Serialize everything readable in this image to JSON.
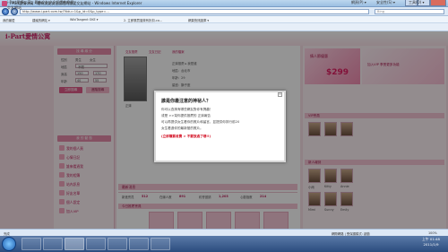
{
  "window": {
    "title": "i-Part愛情公寓 - 最有交友安全認證的戀愛交友網站 - Windows Internet Explorer"
  },
  "address": {
    "url": "http://www.i-part.com.tw/?tidu=1&p_id=0&p_type=...",
    "search_placeholder": "Bing"
  },
  "favorites": {
    "items": [
      "我的最愛",
      "建議的網站 ▾",
      "WikiTangent OKE ▾",
      "2. 立即購買運費有折扣-co...",
      "網頁快訊圖庫 ▾"
    ]
  },
  "tabs": [
    {
      "label": "i-Part愛情公寓 - 最有交友安全認證的戀愛交友網站"
    }
  ],
  "toolbar": {
    "items": [
      "網頁(P) ▾",
      "安全性(S) ▾",
      "工具(O) ▾"
    ]
  },
  "site": {
    "logo": "i-Part愛情公寓",
    "left": {
      "search_head": "找 尋 緣 分",
      "gender_label": "性別",
      "gender_options": [
        "男生",
        "女生"
      ],
      "area_label": "地區",
      "area_value": "不限",
      "height_label": "身高",
      "height_values": [
        "150",
        "170"
      ],
      "age_label": "年齡",
      "age_values": [
        "40",
        "55"
      ],
      "search_button": "立即搜尋",
      "advanced_button": "進階搜尋",
      "my_head": "我 的 動 態",
      "menu": [
        "我的個人頁",
        "心情日記",
        "誰來看過我",
        "我的相簿",
        "站內訊息",
        "好友名單",
        "個人設定",
        "加入VIP"
      ]
    },
    "main": {
      "links": [
        "交友推薦",
        "交友日記",
        "我的檔案"
      ],
      "member_label": "正妹",
      "info_lines": [
        "正妹推薦 ▸ 我是誰",
        "地區：台北市",
        "年齡：29",
        "星座：獅子座",
        "興趣：看電影"
      ],
      "stats_head": "最新消息",
      "stats": [
        {
          "label": "新進會員",
          "value": "512"
        },
        {
          "label": "在線人數",
          "value": "891"
        },
        {
          "label": "約會邀請",
          "value": "1,203"
        },
        {
          "label": "心動指數",
          "value": "214"
        }
      ],
      "avatars_head": "今日推薦會員"
    },
    "right": {
      "ad_price": "$299",
      "ad_text": "情人節優惠",
      "ad2_text": "加入VIP 享受更多功能",
      "vip_head": "VIP會員",
      "new_head": "新人報到",
      "names": [
        "小雨",
        "Kitty",
        "Annie",
        "Mimi",
        "Sunny",
        "Emily"
      ]
    }
  },
  "dialog": {
    "title": "誰是你最注意的神祕人？",
    "lines": [
      "你可以查詢有哪些網友對你有興趣！",
      "或是 >>幫你提供推薦的 正妹報告",
      "可以再提供女生看你的照片和留言，並提供你排行前20",
      "女生看過你的最新發的照片。"
    ],
    "cta": "(立即購買收費 > 不要放過了哦!!)"
  },
  "statusbar": {
    "left": "完成",
    "zone": "網際網路 | 受保護模式: 啟動",
    "zoom": "100%"
  },
  "taskbar": {
    "time": "上午 01:48",
    "date": "2011/1/9"
  },
  "colors": {
    "brand": "#d0246a",
    "page_bg": "#f7dfe6",
    "overlay": "rgba(0,0,0,0.42)",
    "cta_red": "#d20a1e"
  }
}
